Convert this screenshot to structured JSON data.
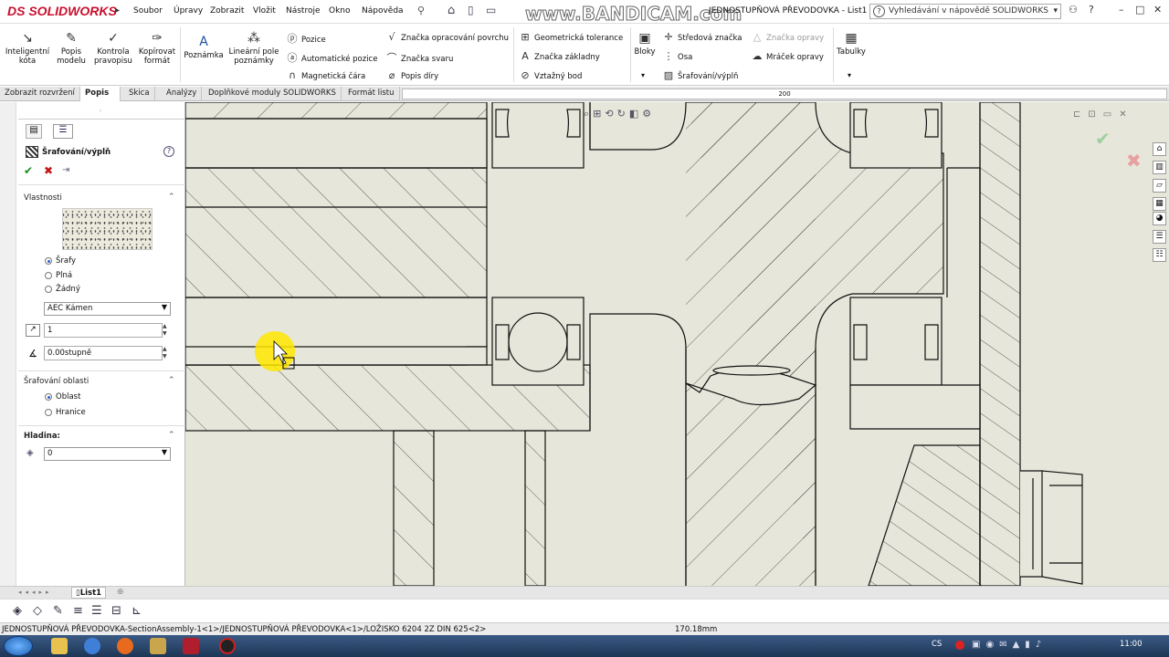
{
  "app": {
    "logo_text": "SOLIDWORKS",
    "logo_prefix": "DS"
  },
  "menu": [
    "Soubor",
    "Úpravy",
    "Zobrazit",
    "Vložit",
    "Nástroje",
    "Okno",
    "Nápověda"
  ],
  "window_title": "JEDNOSTUPŇOVÁ PŘEVODOVKA - List1 *",
  "watermark": "www.BANDICAM.com",
  "search": {
    "placeholder": "Vyhledávání v nápovědě SOLIDWORKS"
  },
  "window_buttons": [
    "?",
    "–",
    "□",
    "✕"
  ],
  "ribbon": {
    "inteligentni_kota": "Inteligentní kóta",
    "popis_modelu": "Popis modelu",
    "kontrola_pravopisu": "Kontrola pravopisu",
    "kopirovat_format": "Kopírovat formát",
    "poznamka": "Poznámka",
    "linearni_pole": "Lineární pole poznámky",
    "pozice": "Pozice",
    "automaticke_pozice": "Automatické pozice",
    "magneticka_cara": "Magnetická čára",
    "znacka_opracovani": "Značka opracování povrchu",
    "znacka_svaru": "Značka svaru",
    "popis_diry": "Popis díry",
    "geometricka_tolerance": "Geometrická tolerance",
    "znacka_zakladny": "Značka základny",
    "vztazny_bod": "Vztažný bod",
    "bloky": "Bloky",
    "stredova_znacka": "Středová značka",
    "osa": "Osa",
    "srafovani": "Šrafování/výplň",
    "znacka_opravy": "Značka opravy",
    "mracek_opravy": "Mráček opravy",
    "tabulky": "Tabulky"
  },
  "tabs": [
    "Zobrazit rozvržení",
    "Popis",
    "Skica",
    "Analýzy",
    "Doplňkové moduly SOLIDWORKS",
    "Formát listu"
  ],
  "active_tab": "Popis",
  "ruler_value": "200",
  "panel": {
    "title": "Šrafování/výplň",
    "help": "?",
    "properties_label": "Vlastnosti",
    "options": [
      "Šrafy",
      "Plná",
      "Žádný"
    ],
    "selected_option": "Šrafy",
    "pattern": "AEC Kámen",
    "scale": "1",
    "angle": "0.00stupně",
    "area_label": "Šrafování oblasti",
    "area_options": [
      "Oblast",
      "Hranice"
    ],
    "selected_area": "Oblast",
    "layer_label": "Hladina:",
    "layer_value": "0"
  },
  "sheet_tab": "List1",
  "status": {
    "path": "JEDNOSTUPŇOVÁ PŘEVODOVKA-SectionAssembly-1<1>/JEDNOSTUPŇOVÁ PŘEVODOVKA<1>/LOŽISKO 6204 2Z DIN 625<2>",
    "measure": "170.18mm"
  },
  "taskbar": {
    "lang": "CS",
    "clock": "11:00"
  },
  "colors": {
    "canvas_bg": "#e6e6da",
    "logo": "#c8102e",
    "cursor_highlight": "#ffe600"
  }
}
